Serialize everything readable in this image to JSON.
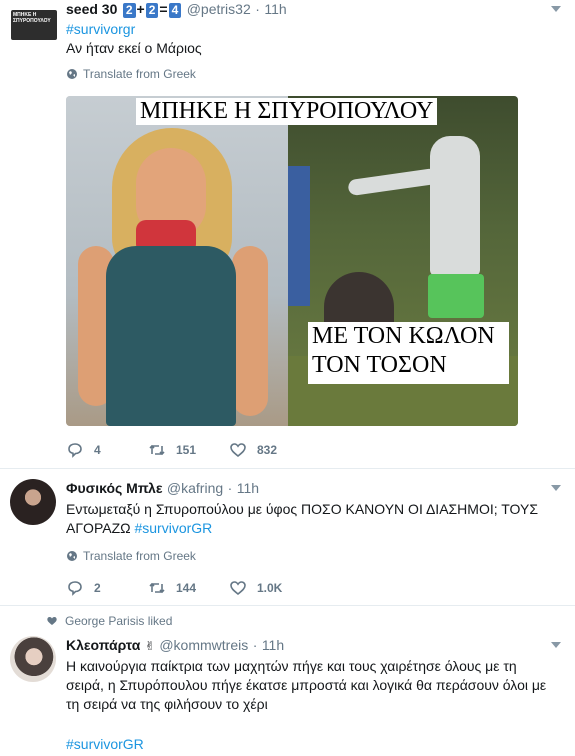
{
  "tweet1": {
    "avatar_text": "ΜΠΗΚΕ Η ΣΠΥΡΟΠΟΥΛΟΥ",
    "display_name": "seed 30",
    "name_badges": [
      "2",
      "+",
      "2",
      "=",
      "4"
    ],
    "handle": "@petris32",
    "time": "11h",
    "hashtag": "#survivorgr",
    "text": "Αν ήταν εκεί ο Μάριος",
    "translate": "Translate from Greek",
    "meme_top": "ΜΠΗΚΕ Η ΣΠΥΡΟΠΟΥΛΟΥ",
    "meme_bottom_1": "ΜΕ ΤΟΝ ΚΩΛΟΝ",
    "meme_bottom_2": "ΤΟΝ ΤΟΣΟΝ",
    "replies": "4",
    "retweets": "151",
    "likes": "832"
  },
  "tweet2": {
    "display_name": "Φυσικός Μπλε",
    "handle": "@kafring",
    "time": "11h",
    "text": "Εντωμεταξύ η Σπυροπούλου με ύφος ΠΟΣΟ ΚΑΝΟΥΝ ΟΙ ΔΙΑΣΗΜΟΙ; ΤΟΥΣ",
    "text2": "ΑΓΟΡΑΖΩ",
    "hashtag": "#survivorGR",
    "translate": "Translate from Greek",
    "replies": "2",
    "retweets": "144",
    "likes": "1.0K"
  },
  "tweet3": {
    "liked_by": "George Parisis liked",
    "display_name": "Κλεοπάρτα",
    "handle": "@kommwtreis",
    "time": "11h",
    "line1": "Η καινούργια παίκτρια των μαχητών πήγε και τους χαιρέτησε όλους με τη",
    "line2": "σειρά, η Σπυρόπουλου πήγε έκατσε μπροστά και λογικά θα περάσουν όλοι με",
    "line3": "τη σειρά να της φιλήσουν το χέρι",
    "hashtag": "#survivorGR"
  },
  "colors": {
    "link": "#1b95e0",
    "meta": "#657786",
    "badge": "#3a78c8"
  }
}
